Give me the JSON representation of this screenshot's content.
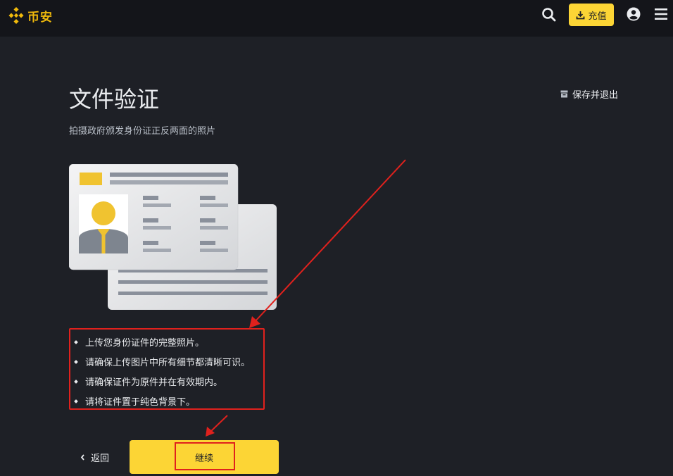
{
  "header": {
    "brand_name": "币安",
    "deposit_label": "充值",
    "icons": [
      "binance-logo-icon",
      "search-icon",
      "download-icon",
      "user-icon",
      "menu-icon"
    ]
  },
  "page": {
    "title": "文件验证",
    "subtitle": "拍摄政府颁发身份证正反两面的照片",
    "save_exit_label": "保存并退出"
  },
  "tips": [
    "上传您身份证件的完整照片。",
    "请确保上传图片中所有细节都清晰可识。",
    "请确保证件为原件并在有效期内。",
    "请将证件置于纯色背景下。"
  ],
  "actions": {
    "back_label": "返回",
    "continue_label": "继续"
  },
  "colors": {
    "page_bg": "#1e2026",
    "header_bg": "#14151a",
    "brand": "#f0b90b",
    "button_yellow": "#fcd535",
    "annotation_red": "#e0211d"
  }
}
